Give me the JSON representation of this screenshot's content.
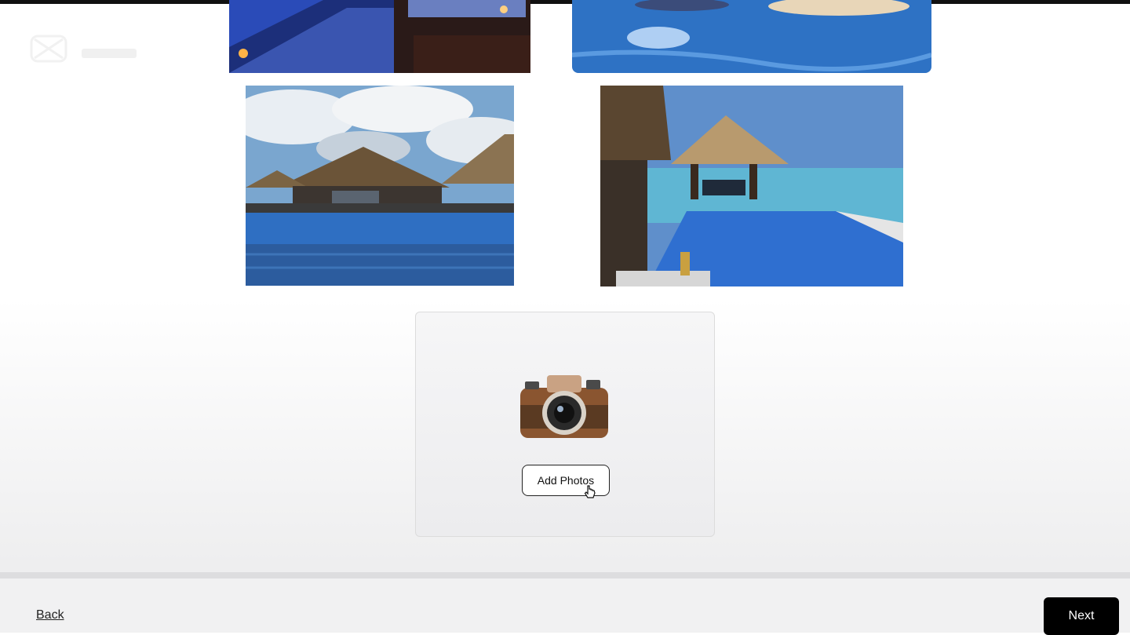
{
  "upload": {
    "button_label": "Add Photos"
  },
  "footer": {
    "back_label": "Back",
    "next_label": "Next"
  },
  "colors": {
    "next_button_bg": "#000000",
    "pool_blue": "#2f6fb8",
    "sky_blue": "#6fa6d8"
  },
  "icons": [
    "app-logo-icon",
    "camera-icon",
    "pointer-cursor-icon"
  ]
}
